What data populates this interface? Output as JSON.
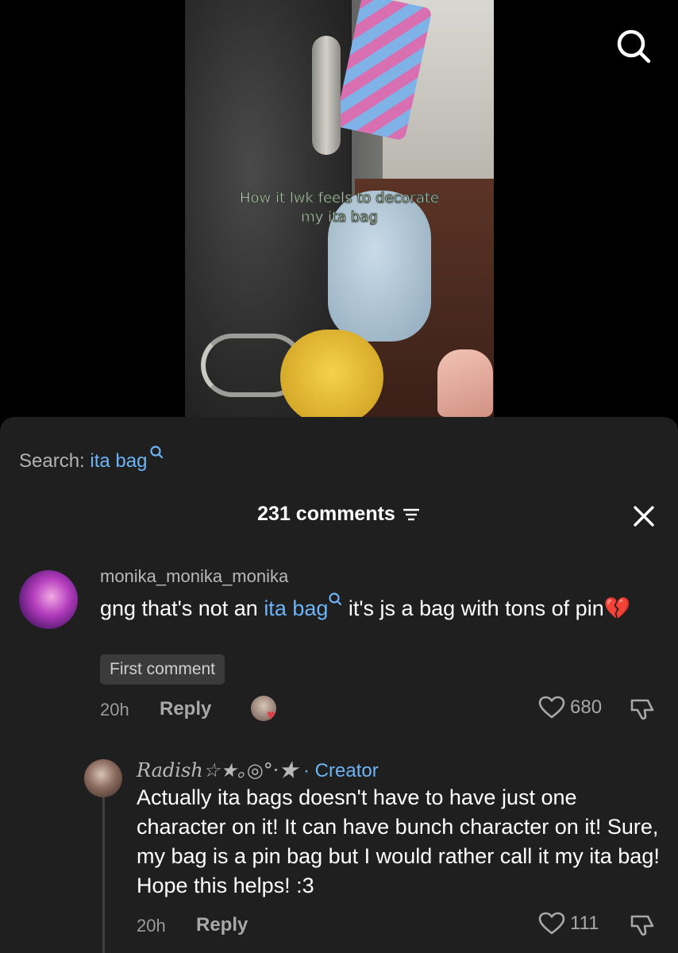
{
  "video": {
    "caption_line1": "How it lwk feels to decorate",
    "caption_line2": "my ita bag",
    "search_icon": "search-icon"
  },
  "search_bar": {
    "prefix": "Search:",
    "keyword": "ita bag"
  },
  "comments_header": {
    "count_label": "231 comments",
    "filter_icon": "filter-icon",
    "close_icon": "close-icon"
  },
  "comments": [
    {
      "username": "monika_monika_monika",
      "text_before": "gng that's not an ",
      "link": "ita bag",
      "text_after": " it's js a bag with tons of pin",
      "emoji": "💔",
      "badge": "First comment",
      "time": "20h",
      "reply_label": "Reply",
      "likes": "680"
    }
  ],
  "reply": {
    "username": "Radish☆★｡◎°·★",
    "separator": " · ",
    "creator_label": "Creator",
    "text": "Actually ita bags doesn't have to have just one character on it! It can have bunch character on it! Sure, my bag is a pin bag but I would rather call it my ita bag! Hope this helps! :3",
    "time": "20h",
    "reply_label": "Reply",
    "likes": "111"
  },
  "colors": {
    "link": "#6cb4f5",
    "sheet_bg": "#1f1f1f",
    "heart": "#e23b46"
  }
}
